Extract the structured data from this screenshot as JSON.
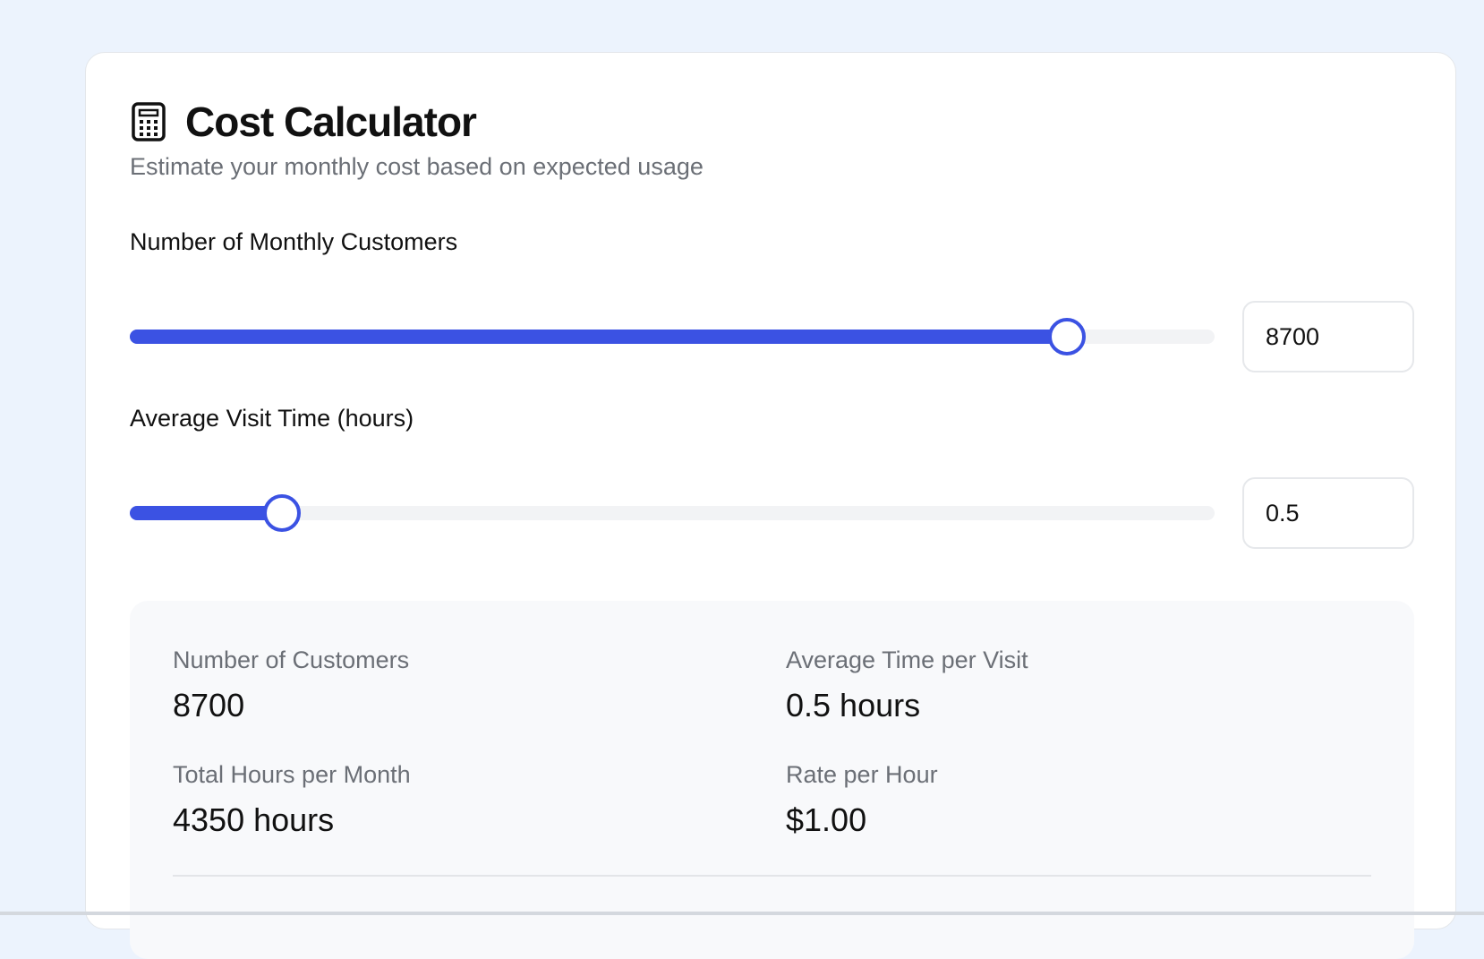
{
  "calculator": {
    "title": "Cost Calculator",
    "subtitle": "Estimate your monthly cost based on expected usage",
    "icon": "calculator-icon"
  },
  "customers_field": {
    "label": "Number of Monthly Customers",
    "value": "8700",
    "slider_fraction": 0.864
  },
  "visit_time_field": {
    "label": "Average Visit Time (hours)",
    "value": "0.5",
    "slider_fraction": 0.14
  },
  "summary": {
    "customers": {
      "label": "Number of Customers",
      "value": "8700"
    },
    "avg_time": {
      "label": "Average Time per Visit",
      "value": "0.5 hours"
    },
    "total_hours": {
      "label": "Total Hours per Month",
      "value": "4350 hours"
    },
    "rate": {
      "label": "Rate per Hour",
      "value": "$1.00"
    }
  },
  "colors": {
    "accent": "#3b52e3",
    "background": "#ecf3fd",
    "card": "#ffffff",
    "summary_bg": "#f8f9fb",
    "muted_text": "#6b6f76"
  }
}
